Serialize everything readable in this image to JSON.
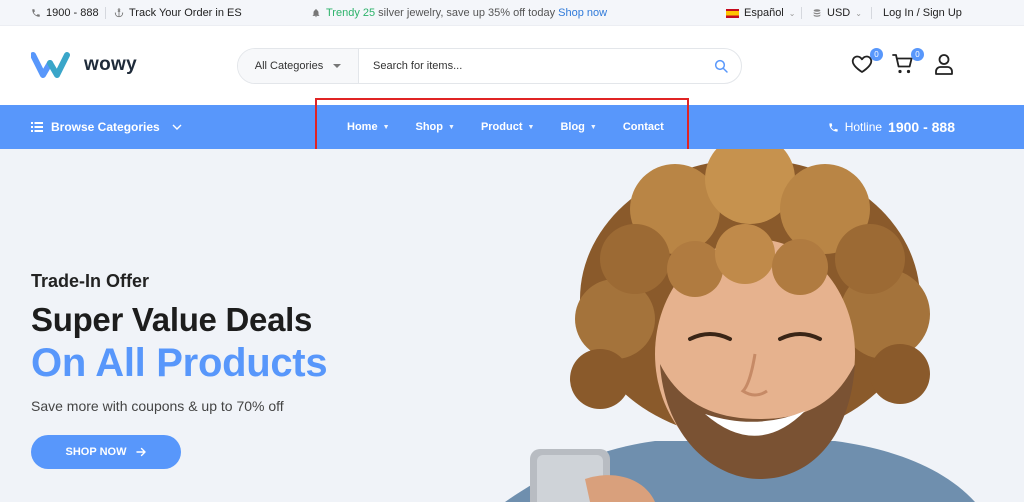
{
  "topbar": {
    "phone": "1900 - 888",
    "track": "Track Your Order in ES",
    "promo_green": "Trendy 25",
    "promo_text": " silver jewelry, save up 35% off today ",
    "promo_link": "Shop now",
    "language": "Español",
    "currency": "USD",
    "login": "Log In / Sign Up"
  },
  "header": {
    "logo": "wowy",
    "category_select": "All Categories",
    "search_placeholder": "Search for items...",
    "wishlist_count": "0",
    "cart_count": "0"
  },
  "nav": {
    "browse": "Browse Categories",
    "items": [
      {
        "label": "Home"
      },
      {
        "label": "Shop"
      },
      {
        "label": "Product"
      },
      {
        "label": "Blog"
      },
      {
        "label": "Contact"
      }
    ],
    "hotline_label": "Hotline",
    "hotline_number": "1900 - 888"
  },
  "hero": {
    "kicker": "Trade-In Offer",
    "title": "Super Value Deals",
    "title_accent": "On All Products",
    "subtitle": "Save more with coupons & up to 70% off",
    "button": "SHOP NOW"
  },
  "colors": {
    "accent": "#5897fb",
    "promo_green": "#2db36b",
    "highlight_border": "#e02424"
  }
}
